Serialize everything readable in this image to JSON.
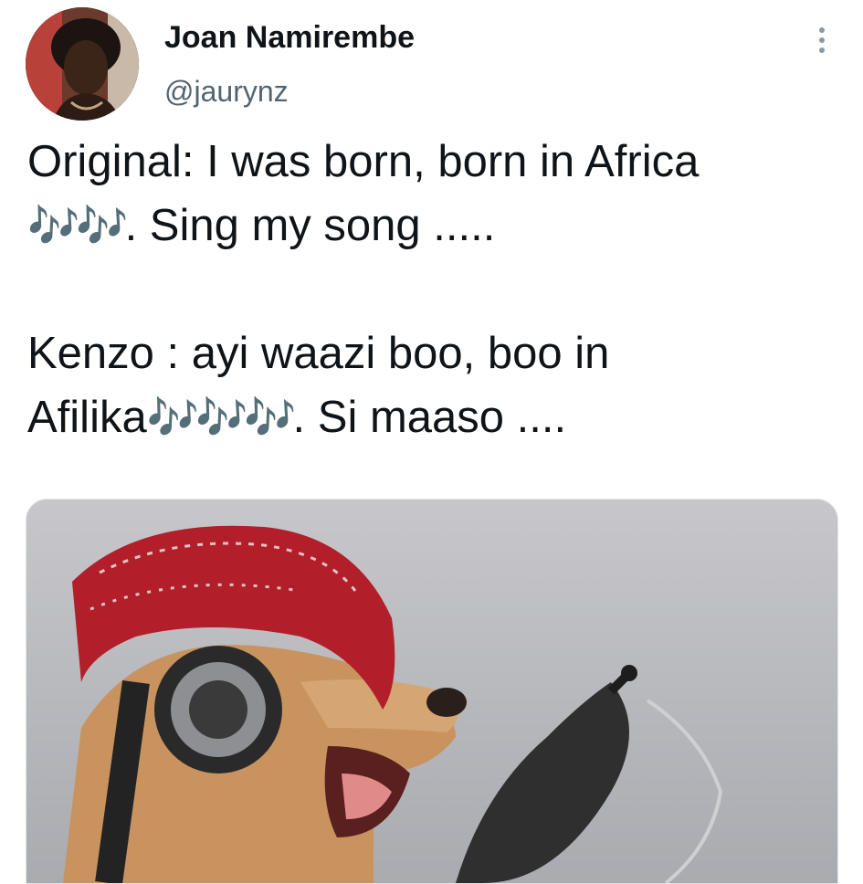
{
  "author": {
    "display_name": "Joan Namirembe",
    "handle": "@jaurynz"
  },
  "tweet": {
    "line1": "Original: I was born, born in Africa",
    "line2_notes": "🎶🎶",
    "line2_text": ". Sing my song .....",
    "line3": "Kenzo : ayi waazi boo, boo in",
    "line4_text_a": "Afilika",
    "line4_notes": "🎶🎶🎶",
    "line4_text_b": ". Si maaso ....",
    "accent_color": "#2aa7e6"
  },
  "actions": {
    "more_icon": "more-vertical-icon"
  },
  "media": {
    "icon": "photo-icon"
  }
}
